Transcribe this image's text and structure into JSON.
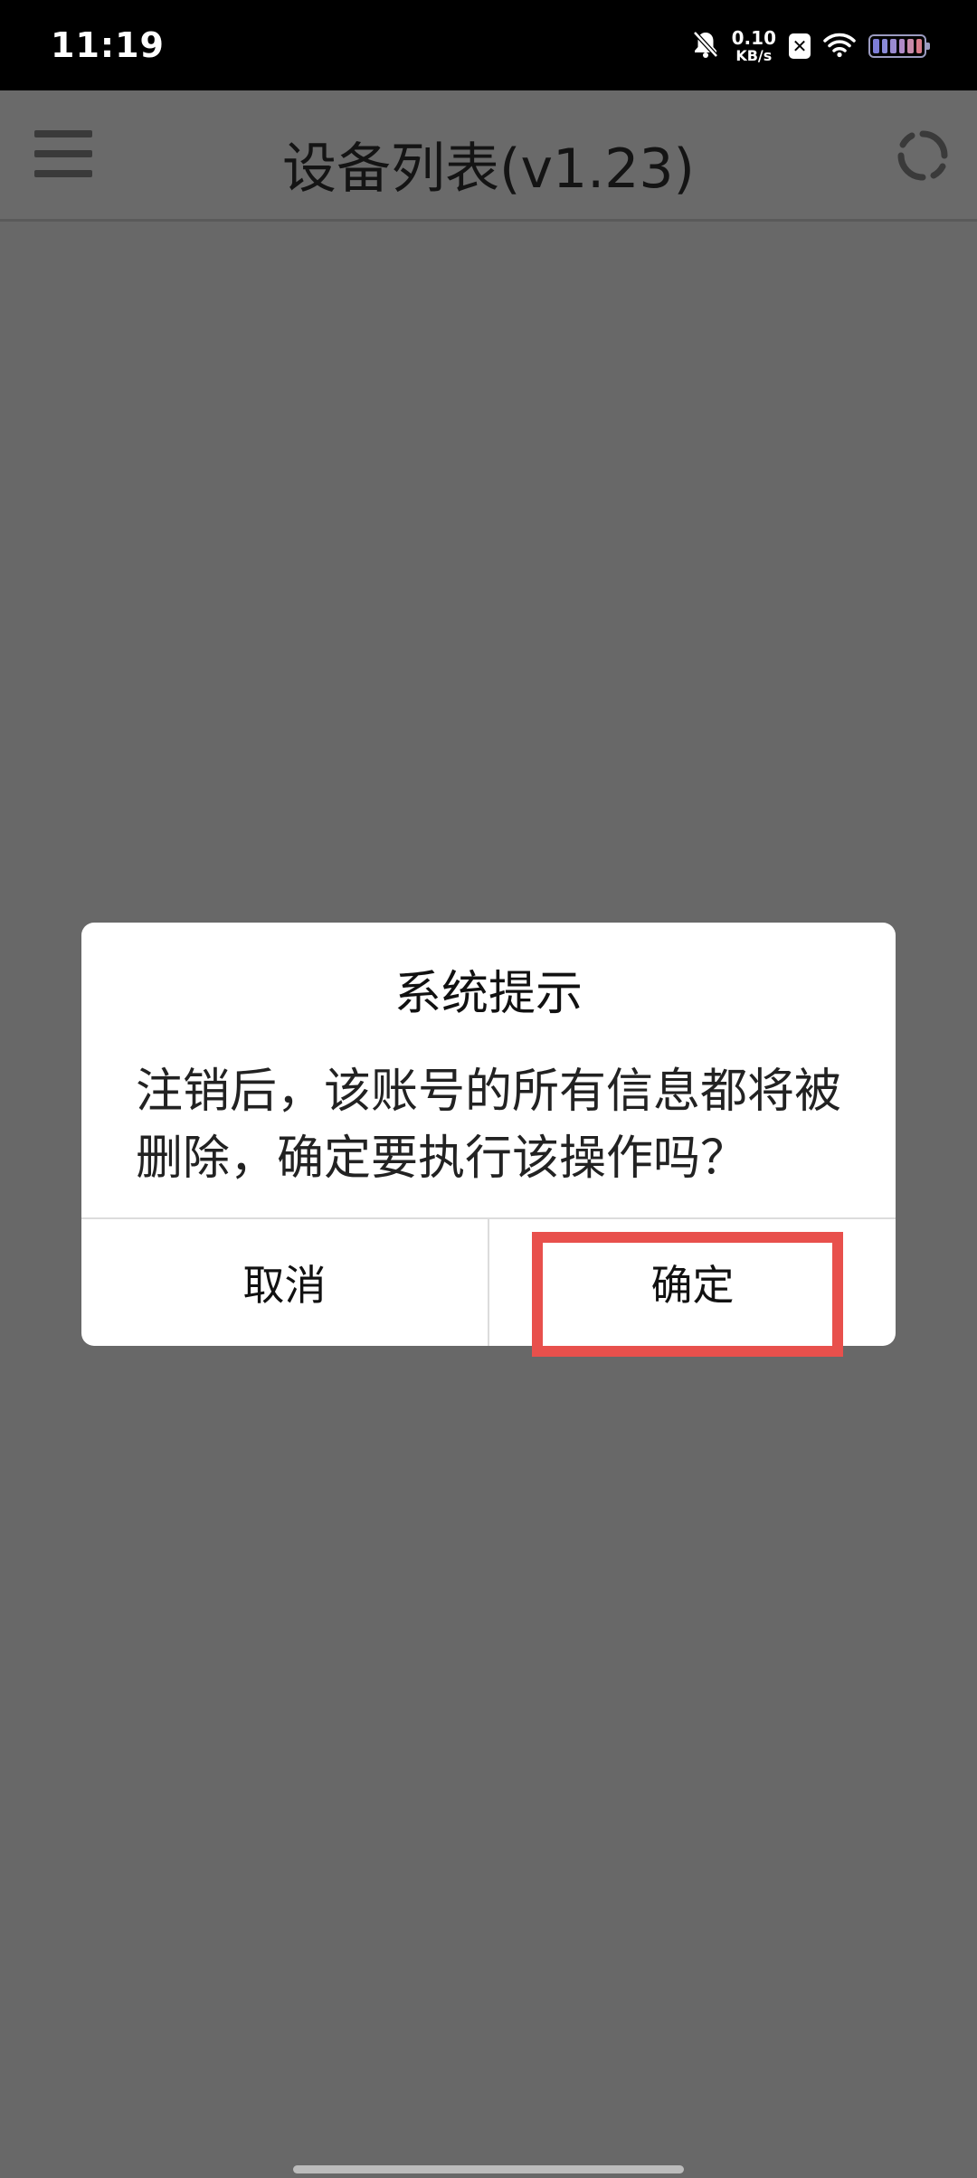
{
  "status_bar": {
    "time": "11:19",
    "net_speed_value": "0.10",
    "net_speed_unit": "KB/s",
    "icons": [
      "bell-muted-icon",
      "sim-x-icon",
      "wifi-icon",
      "battery-icon"
    ],
    "battery_colors": [
      "#7d7dd8",
      "#8a8ad8",
      "#9a8ad0",
      "#b08ac8",
      "#c88aaa",
      "#d87a8a"
    ]
  },
  "app_bar": {
    "title": "设备列表(v1.23)",
    "left_icon": "menu-icon",
    "right_icon": "refresh-icon"
  },
  "dialog": {
    "title": "系统提示",
    "message": "注销后，该账号的所有信息都将被删除，确定要执行该操作吗？",
    "cancel_label": "取消",
    "confirm_label": "确定"
  },
  "colors": {
    "overlay": "#686868",
    "highlight": "#e8504c"
  }
}
